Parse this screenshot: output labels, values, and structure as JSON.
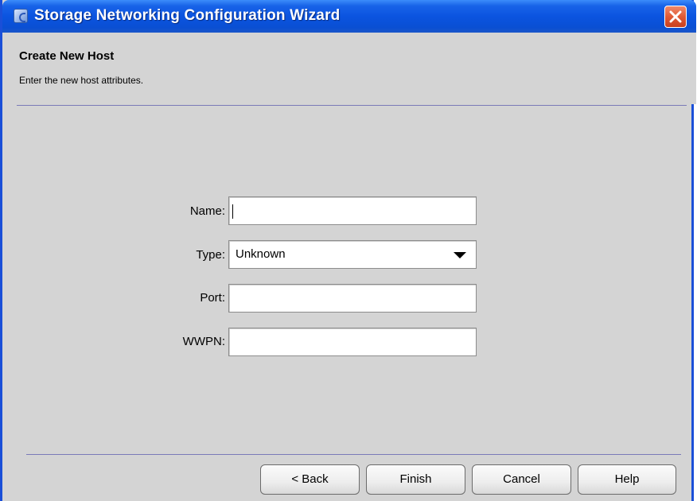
{
  "window": {
    "title": "Storage Networking Configuration Wizard"
  },
  "header": {
    "title": "Create New Host",
    "description": "Enter the new host attributes."
  },
  "form": {
    "name_label": "Name:",
    "name_value": "",
    "type_label": "Type:",
    "type_value": "Unknown",
    "port_label": "Port:",
    "port_value": "",
    "wwpn_label": "WWPN:",
    "wwpn_value": ""
  },
  "buttons": {
    "back": "< Back",
    "finish": "Finish",
    "cancel": "Cancel",
    "help": "Help"
  },
  "colors": {
    "titlebar": "#0b54e0",
    "close_button": "#e05a36",
    "panel_background": "#d4d4d4",
    "separator": "#7a7ab8"
  }
}
